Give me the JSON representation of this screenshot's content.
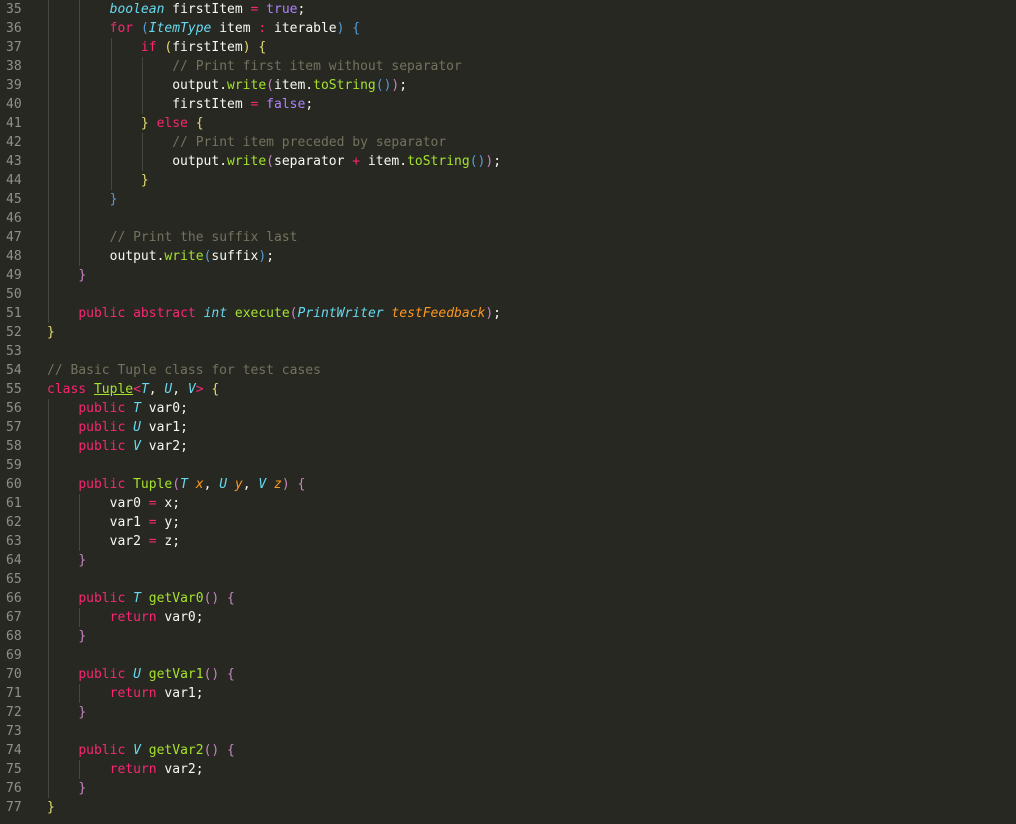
{
  "editor": {
    "theme_colors": {
      "background": "#272822",
      "gutter_text": "#8f908a",
      "default_text": "#f8f8f2",
      "keyword": "#f92672",
      "type": "#66d9ef",
      "function": "#a6e22e",
      "comment": "#75715e",
      "constant": "#ae81ff",
      "parameter": "#fd971f",
      "bracket_gold": "#e6db74",
      "bracket_magenta": "#c586c0",
      "bracket_blue": "#569cd6"
    },
    "lines": [
      {
        "num": "35",
        "tokens": [
          [
            "        ",
            ""
          ],
          [
            "boolean",
            "t-type"
          ],
          [
            " firstItem ",
            ""
          ],
          [
            "=",
            "t-op"
          ],
          [
            " ",
            ""
          ],
          [
            "true",
            "t-num"
          ],
          [
            ";",
            ""
          ]
        ]
      },
      {
        "num": "36",
        "tokens": [
          [
            "        ",
            ""
          ],
          [
            "for",
            "t-kw"
          ],
          [
            " ",
            ""
          ],
          [
            "(",
            "t-b"
          ],
          [
            "ItemType",
            "t-type"
          ],
          [
            " item ",
            ""
          ],
          [
            ":",
            "t-op"
          ],
          [
            " iterable",
            ""
          ],
          [
            ")",
            "t-b"
          ],
          [
            " ",
            ""
          ],
          [
            "{",
            "t-b"
          ]
        ]
      },
      {
        "num": "37",
        "tokens": [
          [
            "            ",
            ""
          ],
          [
            "if",
            "t-kw"
          ],
          [
            " ",
            ""
          ],
          [
            "(",
            "t-y"
          ],
          [
            "firstItem",
            ""
          ],
          [
            ")",
            "t-y"
          ],
          [
            " ",
            ""
          ],
          [
            "{",
            "t-y"
          ]
        ]
      },
      {
        "num": "38",
        "tokens": [
          [
            "                ",
            ""
          ],
          [
            "// Print first item without separator",
            "t-cm"
          ]
        ]
      },
      {
        "num": "39",
        "tokens": [
          [
            "                ",
            ""
          ],
          [
            "output.",
            ""
          ],
          [
            "write",
            "t-fn"
          ],
          [
            "(",
            "t-m"
          ],
          [
            "item.",
            ""
          ],
          [
            "toString",
            "t-fn"
          ],
          [
            "(",
            "t-b"
          ],
          [
            ")",
            "t-b"
          ],
          [
            ")",
            "t-m"
          ],
          [
            ";",
            ""
          ]
        ]
      },
      {
        "num": "40",
        "tokens": [
          [
            "                ",
            ""
          ],
          [
            "firstItem ",
            ""
          ],
          [
            "=",
            "t-op"
          ],
          [
            " ",
            ""
          ],
          [
            "false",
            "t-num"
          ],
          [
            ";",
            ""
          ]
        ]
      },
      {
        "num": "41",
        "tokens": [
          [
            "            ",
            ""
          ],
          [
            "}",
            "t-y"
          ],
          [
            " ",
            ""
          ],
          [
            "else",
            "t-kw"
          ],
          [
            " ",
            ""
          ],
          [
            "{",
            "t-y"
          ]
        ]
      },
      {
        "num": "42",
        "tokens": [
          [
            "                ",
            ""
          ],
          [
            "// Print item preceded by separator",
            "t-cm"
          ]
        ]
      },
      {
        "num": "43",
        "tokens": [
          [
            "                ",
            ""
          ],
          [
            "output.",
            ""
          ],
          [
            "write",
            "t-fn"
          ],
          [
            "(",
            "t-m"
          ],
          [
            "separator ",
            ""
          ],
          [
            "+",
            "t-op"
          ],
          [
            " item.",
            ""
          ],
          [
            "toString",
            "t-fn"
          ],
          [
            "(",
            "t-b"
          ],
          [
            ")",
            "t-b"
          ],
          [
            ")",
            "t-m"
          ],
          [
            ";",
            ""
          ]
        ]
      },
      {
        "num": "44",
        "tokens": [
          [
            "            ",
            ""
          ],
          [
            "}",
            "t-y"
          ]
        ]
      },
      {
        "num": "45",
        "tokens": [
          [
            "        ",
            ""
          ],
          [
            "}",
            "t-b"
          ]
        ]
      },
      {
        "num": "46",
        "tokens": []
      },
      {
        "num": "47",
        "tokens": [
          [
            "        ",
            ""
          ],
          [
            "// Print the suffix last",
            "t-cm"
          ]
        ]
      },
      {
        "num": "48",
        "tokens": [
          [
            "        ",
            ""
          ],
          [
            "output.",
            ""
          ],
          [
            "write",
            "t-fn"
          ],
          [
            "(",
            "t-b"
          ],
          [
            "suffix",
            ""
          ],
          [
            ")",
            "t-b"
          ],
          [
            ";",
            ""
          ]
        ]
      },
      {
        "num": "49",
        "tokens": [
          [
            "    ",
            ""
          ],
          [
            "}",
            "t-m"
          ]
        ]
      },
      {
        "num": "50",
        "tokens": []
      },
      {
        "num": "51",
        "tokens": [
          [
            "    ",
            ""
          ],
          [
            "public",
            "t-kw"
          ],
          [
            " ",
            ""
          ],
          [
            "abstract",
            "t-kw"
          ],
          [
            " ",
            ""
          ],
          [
            "int",
            "t-type"
          ],
          [
            " ",
            ""
          ],
          [
            "execute",
            "t-fn"
          ],
          [
            "(",
            "t-m"
          ],
          [
            "PrintWriter",
            "t-type"
          ],
          [
            " ",
            ""
          ],
          [
            "testFeedback",
            "t-prm"
          ],
          [
            ")",
            "t-m"
          ],
          [
            ";",
            ""
          ]
        ]
      },
      {
        "num": "52",
        "tokens": [
          [
            "}",
            "t-y"
          ]
        ]
      },
      {
        "num": "53",
        "tokens": []
      },
      {
        "num": "54",
        "tokens": [
          [
            "// Basic Tuple class for test cases",
            "t-cm"
          ]
        ]
      },
      {
        "num": "55",
        "tokens": [
          [
            "class",
            "t-kw"
          ],
          [
            " ",
            ""
          ],
          [
            "Tuple",
            "t-cls"
          ],
          [
            "<",
            "t-op"
          ],
          [
            "T",
            "t-type"
          ],
          [
            ", ",
            ""
          ],
          [
            "U",
            "t-type"
          ],
          [
            ", ",
            ""
          ],
          [
            "V",
            "t-type"
          ],
          [
            ">",
            "t-op"
          ],
          [
            " ",
            ""
          ],
          [
            "{",
            "t-y"
          ]
        ]
      },
      {
        "num": "56",
        "tokens": [
          [
            "    ",
            ""
          ],
          [
            "public",
            "t-kw"
          ],
          [
            " ",
            ""
          ],
          [
            "T",
            "t-type"
          ],
          [
            " var0;",
            ""
          ]
        ]
      },
      {
        "num": "57",
        "tokens": [
          [
            "    ",
            ""
          ],
          [
            "public",
            "t-kw"
          ],
          [
            " ",
            ""
          ],
          [
            "U",
            "t-type"
          ],
          [
            " var1;",
            ""
          ]
        ]
      },
      {
        "num": "58",
        "tokens": [
          [
            "    ",
            ""
          ],
          [
            "public",
            "t-kw"
          ],
          [
            " ",
            ""
          ],
          [
            "V",
            "t-type"
          ],
          [
            " var2;",
            ""
          ]
        ]
      },
      {
        "num": "59",
        "tokens": []
      },
      {
        "num": "60",
        "tokens": [
          [
            "    ",
            ""
          ],
          [
            "public",
            "t-kw"
          ],
          [
            " ",
            ""
          ],
          [
            "Tuple",
            "t-fn"
          ],
          [
            "(",
            "t-m"
          ],
          [
            "T",
            "t-type"
          ],
          [
            " ",
            ""
          ],
          [
            "x",
            "t-prm"
          ],
          [
            ", ",
            ""
          ],
          [
            "U",
            "t-type"
          ],
          [
            " ",
            ""
          ],
          [
            "y",
            "t-prm"
          ],
          [
            ", ",
            ""
          ],
          [
            "V",
            "t-type"
          ],
          [
            " ",
            ""
          ],
          [
            "z",
            "t-prm"
          ],
          [
            ")",
            "t-m"
          ],
          [
            " ",
            ""
          ],
          [
            "{",
            "t-m"
          ]
        ]
      },
      {
        "num": "61",
        "tokens": [
          [
            "        ",
            ""
          ],
          [
            "var0 ",
            ""
          ],
          [
            "=",
            "t-op"
          ],
          [
            " x;",
            ""
          ]
        ]
      },
      {
        "num": "62",
        "tokens": [
          [
            "        ",
            ""
          ],
          [
            "var1 ",
            ""
          ],
          [
            "=",
            "t-op"
          ],
          [
            " y;",
            ""
          ]
        ]
      },
      {
        "num": "63",
        "tokens": [
          [
            "        ",
            ""
          ],
          [
            "var2 ",
            ""
          ],
          [
            "=",
            "t-op"
          ],
          [
            " z;",
            ""
          ]
        ]
      },
      {
        "num": "64",
        "tokens": [
          [
            "    ",
            ""
          ],
          [
            "}",
            "t-m"
          ]
        ]
      },
      {
        "num": "65",
        "tokens": []
      },
      {
        "num": "66",
        "tokens": [
          [
            "    ",
            ""
          ],
          [
            "public",
            "t-kw"
          ],
          [
            " ",
            ""
          ],
          [
            "T",
            "t-type"
          ],
          [
            " ",
            ""
          ],
          [
            "getVar0",
            "t-fn"
          ],
          [
            "(",
            "t-m"
          ],
          [
            ")",
            "t-m"
          ],
          [
            " ",
            ""
          ],
          [
            "{",
            "t-m"
          ]
        ]
      },
      {
        "num": "67",
        "tokens": [
          [
            "        ",
            ""
          ],
          [
            "return",
            "t-kw"
          ],
          [
            " var0;",
            ""
          ]
        ]
      },
      {
        "num": "68",
        "tokens": [
          [
            "    ",
            ""
          ],
          [
            "}",
            "t-m"
          ]
        ]
      },
      {
        "num": "69",
        "tokens": []
      },
      {
        "num": "70",
        "tokens": [
          [
            "    ",
            ""
          ],
          [
            "public",
            "t-kw"
          ],
          [
            " ",
            ""
          ],
          [
            "U",
            "t-type"
          ],
          [
            " ",
            ""
          ],
          [
            "getVar1",
            "t-fn"
          ],
          [
            "(",
            "t-m"
          ],
          [
            ")",
            "t-m"
          ],
          [
            " ",
            ""
          ],
          [
            "{",
            "t-m"
          ]
        ]
      },
      {
        "num": "71",
        "tokens": [
          [
            "        ",
            ""
          ],
          [
            "return",
            "t-kw"
          ],
          [
            " var1;",
            ""
          ]
        ]
      },
      {
        "num": "72",
        "tokens": [
          [
            "    ",
            ""
          ],
          [
            "}",
            "t-m"
          ]
        ]
      },
      {
        "num": "73",
        "tokens": []
      },
      {
        "num": "74",
        "tokens": [
          [
            "    ",
            ""
          ],
          [
            "public",
            "t-kw"
          ],
          [
            " ",
            ""
          ],
          [
            "V",
            "t-type"
          ],
          [
            " ",
            ""
          ],
          [
            "getVar2",
            "t-fn"
          ],
          [
            "(",
            "t-m"
          ],
          [
            ")",
            "t-m"
          ],
          [
            " ",
            ""
          ],
          [
            "{",
            "t-m"
          ]
        ]
      },
      {
        "num": "75",
        "tokens": [
          [
            "        ",
            ""
          ],
          [
            "return",
            "t-kw"
          ],
          [
            " var2;",
            ""
          ]
        ]
      },
      {
        "num": "76",
        "tokens": [
          [
            "    ",
            ""
          ],
          [
            "}",
            "t-m"
          ]
        ]
      },
      {
        "num": "77",
        "tokens": [
          [
            "}",
            "t-y"
          ]
        ]
      }
    ]
  }
}
